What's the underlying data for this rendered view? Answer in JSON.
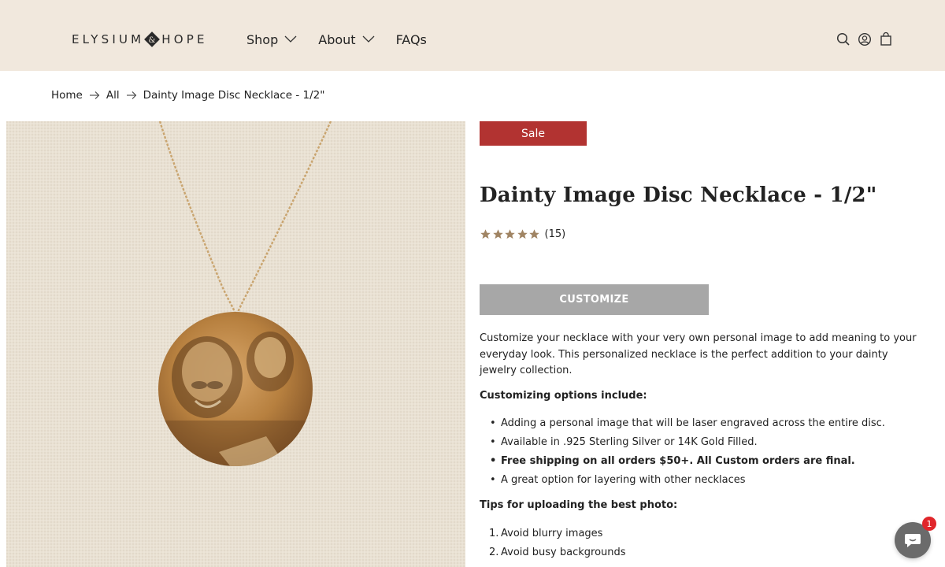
{
  "brand": {
    "logo_left": "ELYSIUM",
    "logo_right": "HOPE"
  },
  "nav": {
    "items": [
      {
        "label": "Shop"
      },
      {
        "label": "About"
      },
      {
        "label": "FAQs"
      }
    ]
  },
  "header_icons": [
    "search-icon",
    "account-icon",
    "cart-icon"
  ],
  "breadcrumb": {
    "items": [
      "Home",
      "All",
      "Dainty Image Disc Necklace - 1/2\""
    ]
  },
  "product": {
    "badge": "Sale",
    "title": "Dainty Image Disc Necklace - 1/2\"",
    "rating_stars": 5,
    "review_count": "(15)",
    "customize_label": "CUSTOMIZE",
    "description": "Customize your necklace with your very own personal image to add meaning to your everyday look. This personalized necklace is the perfect addition to your dainty jewelry collection.",
    "options_heading": "Customizing options include:",
    "options": [
      "Adding a personal image that will be laser engraved across the entire disc.",
      "Available in .925 Sterling Silver or 14K Gold Filled.",
      "Free shipping on all orders $50+. All Custom orders are final.",
      "A great option for layering with other necklaces"
    ],
    "tips_heading": "Tips for uploading the best photo:",
    "tips": [
      {
        "num": "1.",
        "text": "Avoid blurry images"
      },
      {
        "num": "2.",
        "text": "Avoid busy backgrounds"
      }
    ]
  },
  "chat": {
    "badge_count": "1"
  },
  "colors": {
    "header_bg": "#f1e8dd",
    "sale_badge": "#b23331",
    "star": "#a08463",
    "customize_btn": "#a7a7a7"
  }
}
